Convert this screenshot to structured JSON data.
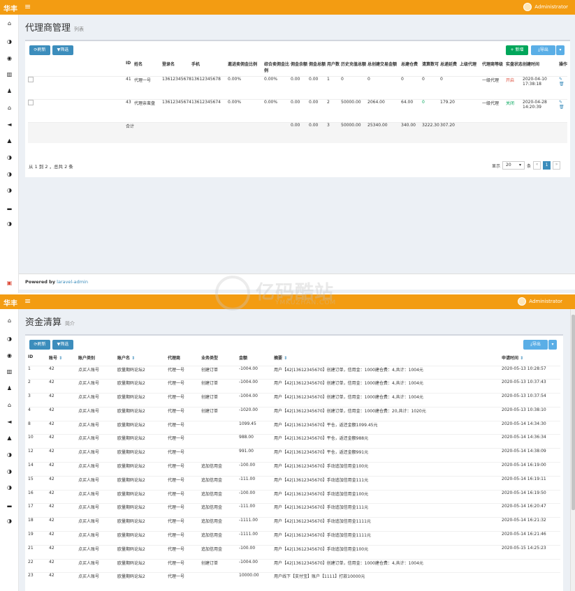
{
  "top": {
    "brand": "华丰",
    "user": "Administrator",
    "title": "代理商管理",
    "subtitle": "列表",
    "refresh": "刷新",
    "filter": "筛选",
    "add": "+ 新增",
    "export": "导出",
    "headers": [
      "ID",
      "姓名",
      "登录名",
      "手机",
      "邀进卖佣金比例",
      "综合卖佣金比例",
      "佣金余额",
      "佣金总额",
      "用户数",
      "历史充值总额",
      "总创建交易金额",
      "总建仓费",
      "清算数可",
      "总递延费",
      "上级代理",
      "代理商等级",
      "实盘状态",
      "创建时间",
      "操作"
    ],
    "rows": [
      [
        "41",
        "代理一号",
        "13612345678",
        "13612345678",
        "0.00%",
        "0.00%",
        "0.00",
        "0.00",
        "1",
        "0",
        "0",
        "0",
        "0",
        "0",
        "",
        "一级代理",
        "开启",
        "2020-04-10 17:38:18"
      ],
      [
        "43",
        "代理亲蛮盘",
        "13612345674",
        "13612345674",
        "0.00%",
        "0.00%",
        "0.00",
        "0.00",
        "2",
        "50000.00",
        "2064.00",
        "64.00",
        "0",
        "179.20",
        "",
        "一级代理",
        "关闭",
        "2020-04-28 14:20:39"
      ]
    ],
    "total": [
      "合计",
      "0.00",
      "0.00",
      "3",
      "50000.00",
      "25340.00",
      "340.00",
      "3222.30",
      "307.20"
    ],
    "summary": "从 1 到 2 ，总共 2 条",
    "show": "显示",
    "per_page": "20",
    "unit": "条",
    "page": "1",
    "footer_prefix": "Powered by",
    "footer_link": "laravel-admin"
  },
  "bottom": {
    "brand": "华丰",
    "user": "Administrator",
    "title": "资金清算",
    "subtitle": "简介",
    "refresh": "刷新",
    "filter": "筛选",
    "export": "导出",
    "headers": [
      "ID",
      "账号",
      "账户类别",
      "账户名",
      "代理商",
      "业务类型",
      "金额",
      "摘要",
      "申请时间"
    ],
    "rows": [
      [
        "1",
        "42",
        "点买人账号",
        "欧量期码论坛2",
        "代理一号",
        "创建订单",
        "-1004.00",
        "用户【42|13612345670】创建订单，信用金：1000建仓费：4,共计：1004元",
        "2020-05-13 10:28:57"
      ],
      [
        "2",
        "42",
        "点买人账号",
        "欧量期码论坛2",
        "代理一号",
        "创建订单",
        "-1004.00",
        "用户【42|13612345670】创建订单，信用金：1000建仓费：4,共计：1004元",
        "2020-05-13 10:37:43"
      ],
      [
        "3",
        "42",
        "点买人账号",
        "欧量期码论坛2",
        "代理一号",
        "创建订单",
        "-1004.00",
        "用户【42|13612345670】创建订单，信用金：1000建仓费：4,共计：1004元",
        "2020-05-13 10:37:54"
      ],
      [
        "4",
        "42",
        "点买人账号",
        "欧量期码论坛2",
        "代理一号",
        "创建订单",
        "-1020.00",
        "用户【42|13612345670】创建订单，信用金：1000建仓费：20,共计：1020元",
        "2020-05-13 10:38:10"
      ],
      [
        "8",
        "42",
        "点买人账号",
        "欧量期码论坛2",
        "代理一号",
        "",
        "1099.45",
        "用户【42|13612345670】平仓，返还金额1099.45元",
        "2020-05-14 14:34:30"
      ],
      [
        "10",
        "42",
        "点买人账号",
        "欧量期码论坛2",
        "代理一号",
        "",
        "988.00",
        "用户【42|13612345670】平仓，返还金额988元",
        "2020-05-14 14:36:34"
      ],
      [
        "12",
        "42",
        "点买人账号",
        "欧量期码论坛2",
        "代理一号",
        "",
        "991.00",
        "用户【42|13612345670】平仓，返还金额991元",
        "2020-05-14 14:38:09"
      ],
      [
        "14",
        "42",
        "点买人账号",
        "欧量期码论坛2",
        "代理一号",
        "追加信用金",
        "-100.00",
        "用户【42|13612345670】手动追加信用金100元",
        "2020-05-14 16:19:00"
      ],
      [
        "15",
        "42",
        "点买人账号",
        "欧量期码论坛2",
        "代理一号",
        "追加信用金",
        "-111.00",
        "用户【42|13612345670】手动追加信用金111元",
        "2020-05-14 16:19:11"
      ],
      [
        "16",
        "42",
        "点买人账号",
        "欧量期码论坛2",
        "代理一号",
        "追加信用金",
        "-100.00",
        "用户【42|13612345670】手动追加信用金100元",
        "2020-05-14 16:19:50"
      ],
      [
        "17",
        "42",
        "点买人账号",
        "欧量期码论坛2",
        "代理一号",
        "追加信用金",
        "-111.00",
        "用户【42|13612345670】手动追加信用金111元",
        "2020-05-14 16:20:47"
      ],
      [
        "18",
        "42",
        "点买人账号",
        "欧量期码论坛2",
        "代理一号",
        "追加信用金",
        "-1111.00",
        "用户【42|13612345670】手动追加信用金1111元",
        "2020-05-14 16:21:32"
      ],
      [
        "19",
        "42",
        "点买人账号",
        "欧量期码论坛2",
        "代理一号",
        "追加信用金",
        "-1111.00",
        "用户【42|13612345670】手动追加信用金1111元",
        "2020-05-14 16:21:46"
      ],
      [
        "21",
        "42",
        "点买人账号",
        "欧量期码论坛2",
        "代理一号",
        "追加信用金",
        "-100.00",
        "用户【42|13612345670】手动追加信用金100元",
        "2020-05-15 14:25:23"
      ],
      [
        "22",
        "42",
        "点买人账号",
        "欧量期码论坛2",
        "代理一号",
        "创建订单",
        "-1004.00",
        "用户【42|13612345670】创建订单，信用金：1000建仓费：4,共计：1004元",
        ""
      ],
      [
        "23",
        "42",
        "点买人账号",
        "欧量期码论坛2",
        "代理一号",
        "",
        "10000.00",
        "用户线下【支付宝】账户【1111】打款10000元",
        ""
      ]
    ]
  },
  "watermark": {
    "main": "亿码酷站",
    "sub": "YMKUZHAN.COM"
  },
  "colors": {
    "header": "#f39c12",
    "primary": "#3c8dbc",
    "success": "#00a65a",
    "danger": "#dd4b39"
  }
}
